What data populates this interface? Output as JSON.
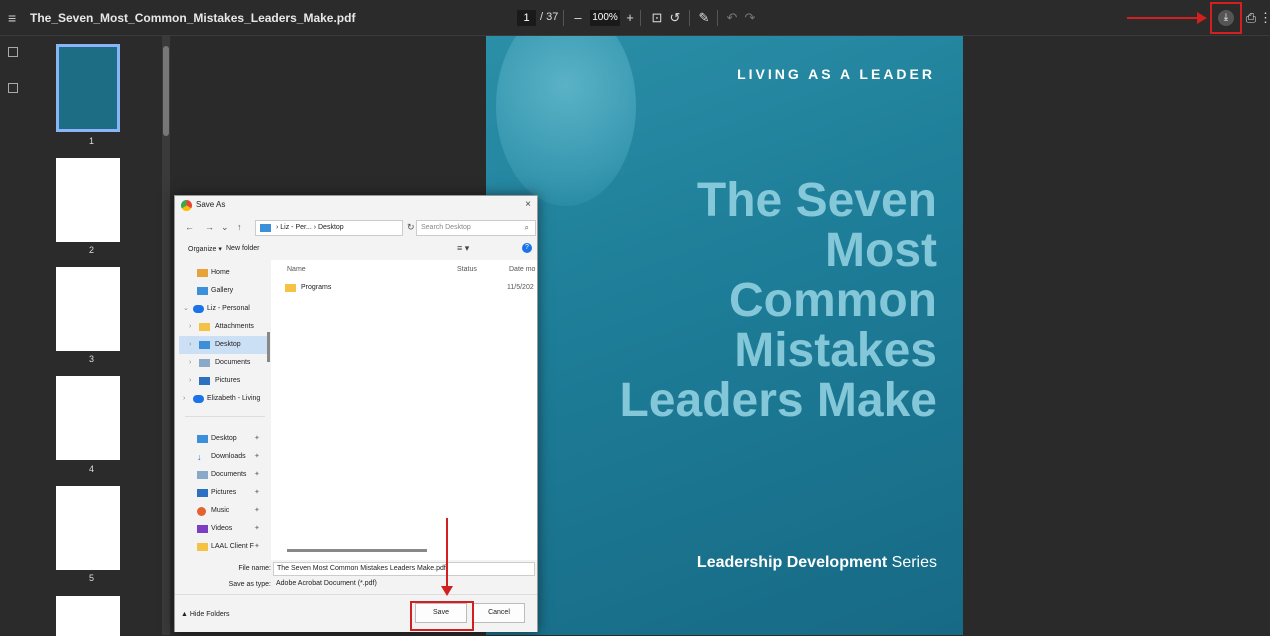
{
  "viewer": {
    "file_title": "The_Seven_Most_Common_Mistakes_Leaders_Make.pdf",
    "current_page": "1",
    "total_pages": "/ 37",
    "zoom": "100%",
    "icons": {
      "menu": "≡",
      "zoom_out": "–",
      "zoom_in": "+",
      "fit": "⊡",
      "rotate": "↺",
      "annotate": "✎",
      "undo": "↶",
      "redo": "↷",
      "download": "⤓",
      "print": "⎙",
      "more": "⋮"
    }
  },
  "thumbnails": [
    {
      "label": "1"
    },
    {
      "label": "2"
    },
    {
      "label": "3"
    },
    {
      "label": "4"
    },
    {
      "label": "5"
    }
  ],
  "cover": {
    "top_series": "LIVING AS A LEADER",
    "title_lines": [
      "The Seven",
      "Most",
      "Common",
      "Mistakes",
      "Leaders Make"
    ],
    "series_bold": "Leadership Development",
    "series_rest": " Series"
  },
  "dialog": {
    "title": "Save As",
    "close": "×",
    "address": "› Liz - Per... › Desktop",
    "search_placeholder": "Search Desktop",
    "organize": "Organize ▾",
    "new_folder": "New folder",
    "nav": {
      "home": "Home",
      "gallery": "Gallery",
      "liz_personal": "Liz - Personal",
      "attachments": "Attachments",
      "desktop": "Desktop",
      "documents": "Documents",
      "pictures": "Pictures",
      "elizabeth": "Elizabeth - Living",
      "quick_desktop": "Desktop",
      "quick_downloads": "Downloads",
      "quick_documents": "Documents",
      "quick_pictures": "Pictures",
      "quick_music": "Music",
      "quick_videos": "Videos",
      "quick_laal": "LAAL Client F"
    },
    "columns": {
      "name": "Name",
      "status": "Status",
      "date": "Date mo"
    },
    "files": [
      {
        "name": "Programs",
        "date": "11/5/202"
      }
    ],
    "file_name_label": "File name:",
    "file_name_value": "The Seven Most Common Mistakes Leaders Make.pdf",
    "save_type_label": "Save as type:",
    "save_type_value": "Adobe Acrobat Document (*.pdf)",
    "hide_folders": "Hide Folders",
    "save_label": "Save",
    "cancel_label": "Cancel"
  },
  "colors": {
    "annotation": "#d21f1f",
    "cover_bg": "#1d7c97",
    "toolbar_bg": "#2b2b2b"
  }
}
